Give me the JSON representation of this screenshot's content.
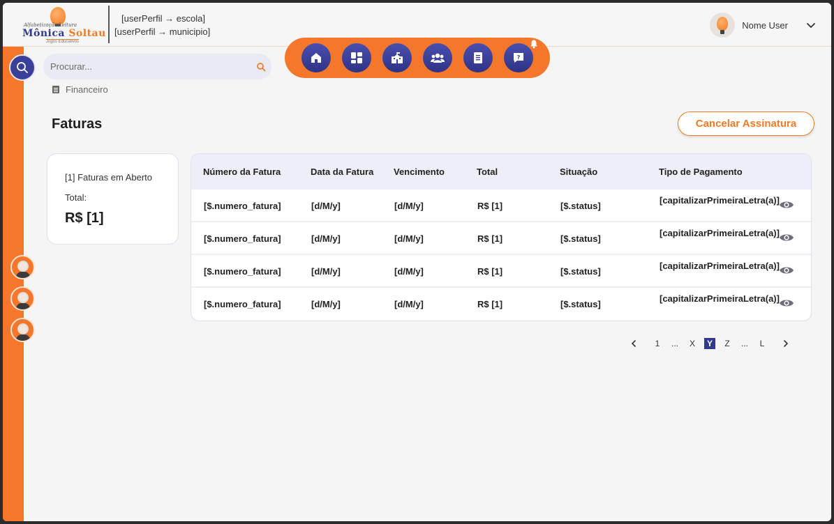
{
  "header": {
    "logo": {
      "tag": "Alfabetização   Leitura",
      "brand_a": "Mônica",
      "brand_b": "Soltau",
      "sub": "Jogos Educativos"
    },
    "profile_line1": "[userPerfil → escola]",
    "profile_line2": "[userPerfil → municipio]",
    "user_name": "Nome User"
  },
  "search": {
    "placeholder": "Procurar..."
  },
  "breadcrumb": {
    "label": "Financeiro"
  },
  "page": {
    "title": "Faturas",
    "cancel_label": "Cancelar Assinatura"
  },
  "summary": {
    "open_invoices": "[1] Faturas em Aberto",
    "total_label": "Total:",
    "total_value": "R$ [1]"
  },
  "table": {
    "headers": [
      "Número da Fatura",
      "Data da Fatura",
      "Vencimento",
      "Total",
      "Situação",
      "Tipo de Pagamento"
    ],
    "rows": [
      [
        "[$.numero_fatura]",
        "[d/M/y]",
        "[d/M/y]",
        "R$ [1]",
        "[$.status]",
        "[capitalizarPrimeiraLetra(a)]"
      ],
      [
        "[$.numero_fatura]",
        "[d/M/y]",
        "[d/M/y]",
        "R$ [1]",
        "[$.status]",
        "[capitalizarPrimeiraLetra(a)]"
      ],
      [
        "[$.numero_fatura]",
        "[d/M/y]",
        "[d/M/y]",
        "R$ [1]",
        "[$.status]",
        "[capitalizarPrimeiraLetra(a)]"
      ],
      [
        "[$.numero_fatura]",
        "[d/M/y]",
        "[d/M/y]",
        "R$ [1]",
        "[$.status]",
        "[capitalizarPrimeiraLetra(a)]"
      ]
    ]
  },
  "pagination": {
    "items": [
      "1",
      "...",
      "X",
      "Y",
      "Z",
      "...",
      "L"
    ],
    "active": "Y"
  },
  "colors": {
    "accent": "#f5772b",
    "primary": "#2f3a8f",
    "background": "#f5f5f6"
  },
  "icons": {
    "nav": [
      "home-icon",
      "dashboard-icon",
      "school-icon",
      "users-icon",
      "document-icon",
      "help-icon"
    ],
    "notification": "bell-icon",
    "row_action": "eye-icon"
  }
}
